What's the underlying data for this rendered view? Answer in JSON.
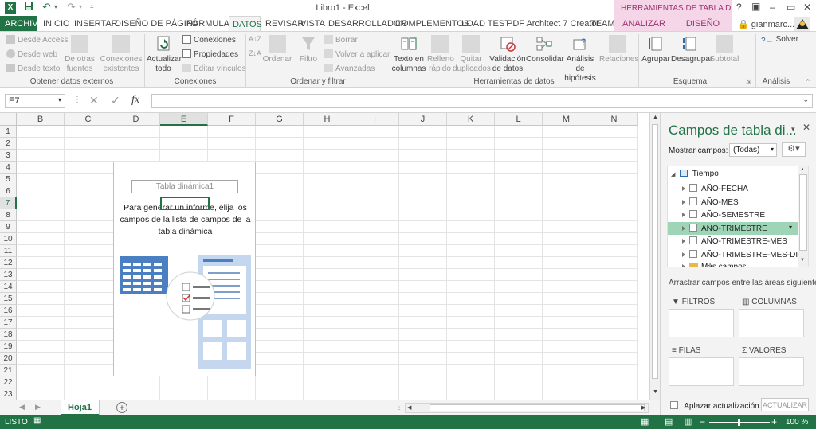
{
  "title_bar": {
    "document_title": "Libro1 - Excel",
    "context_header": "HERRAMIENTAS DE TABLA DINÁ...",
    "help": "?",
    "user": "gianmarc...",
    "quick_access": [
      "save-icon",
      "undo-icon",
      "redo-icon"
    ]
  },
  "tabs": [
    {
      "label": "ARCHIVO",
      "kind": "file"
    },
    {
      "label": "INICIO"
    },
    {
      "label": "INSERTAR"
    },
    {
      "label": "DISEÑO DE PÁGINA"
    },
    {
      "label": "FÓRMULAS"
    },
    {
      "label": "DATOS",
      "active": true
    },
    {
      "label": "REVISAR"
    },
    {
      "label": "VISTA"
    },
    {
      "label": "DESARROLLADOR"
    },
    {
      "label": "COMPLEMENTOS"
    },
    {
      "label": "LOAD TEST"
    },
    {
      "label": "PDF Architect 7 Creator"
    },
    {
      "label": "TEAM"
    },
    {
      "label": "ANALIZAR",
      "kind": "context"
    },
    {
      "label": "DISEÑO",
      "kind": "context"
    }
  ],
  "ribbon": {
    "external_data": {
      "group_label": "Obtener datos externos",
      "from_access": "Desde Access",
      "from_web": "Desde web",
      "from_text": "Desde texto",
      "other_sources": "De otras fuentes",
      "existing_connections": "Conexiones existentes"
    },
    "connections": {
      "group_label": "Conexiones",
      "refresh_all": "Actualizar todo",
      "connections": "Conexiones",
      "properties": "Propiedades",
      "edit_links": "Editar vínculos"
    },
    "sort_filter": {
      "group_label": "Ordenar y filtrar",
      "sort": "Ordenar",
      "filter": "Filtro",
      "clear": "Borrar",
      "reapply": "Volver a aplicar",
      "advanced": "Avanzadas"
    },
    "data_tools": {
      "group_label": "Herramientas de datos",
      "text_to_columns": "Texto en columnas",
      "flash_fill": "Relleno rápido",
      "remove_duplicates": "Quitar duplicados",
      "data_validation": "Validación de datos",
      "consolidate": "Consolidar",
      "what_if": "Análisis de hipótesis",
      "relationships": "Relaciones"
    },
    "outline": {
      "group_label": "Esquema",
      "group": "Agrupar",
      "ungroup": "Desagrupar",
      "subtotal": "Subtotal"
    },
    "analysis": {
      "group_label": "Análisis",
      "solver": "Solver"
    }
  },
  "formula_bar": {
    "name_box": "E7",
    "fx": "fx",
    "formula": ""
  },
  "grid": {
    "columns": [
      "B",
      "C",
      "D",
      "E",
      "F",
      "G",
      "H",
      "I",
      "J",
      "K",
      "L",
      "M",
      "N"
    ],
    "selected_column": "E",
    "rows": [
      "1",
      "2",
      "3",
      "4",
      "5",
      "6",
      "7",
      "8",
      "9",
      "10",
      "11",
      "12",
      "13",
      "14",
      "15",
      "16",
      "17",
      "18",
      "19",
      "20",
      "21",
      "22",
      "23"
    ],
    "selected_row": "7"
  },
  "pivot_placeholder": {
    "name": "Tabla dinámica1",
    "message": "Para generar un informe, elija los campos de la lista de campos de la tabla dinámica"
  },
  "sheets": {
    "tabs": [
      "Hoja1"
    ],
    "active": "Hoja1"
  },
  "status_bar": {
    "ready": "LISTO",
    "zoom": "100 %"
  },
  "field_pane": {
    "title": "Campos de tabla di...",
    "show_fields_label": "Mostrar campos:",
    "show_fields_value": "(Todas)",
    "table_name": "Tiempo",
    "fields": [
      {
        "label": "AÑO-FECHA"
      },
      {
        "label": "AÑO-MES"
      },
      {
        "label": "AÑO-SEMESTRE"
      },
      {
        "label": "AÑO-TRIMESTRE",
        "highlighted": true
      },
      {
        "label": "AÑO-TRIMESTRE-MES"
      },
      {
        "label": "AÑO-TRIMESTRE-MES-DIA"
      },
      {
        "label": "Más campos"
      }
    ],
    "drag_hint": "Arrastrar campos entre las áreas siguientes:",
    "areas": {
      "filters": "FILTROS",
      "columns": "COLUMNAS",
      "rows": "FILAS",
      "values": "VALORES"
    },
    "defer_update": "Aplazar actualización...",
    "update_button": "ACTUALIZAR"
  },
  "colors": {
    "excel_green": "#217346",
    "context_pink": "#f4d6e8",
    "context_text": "#a0336f",
    "highlight": "#9fd5b7"
  }
}
